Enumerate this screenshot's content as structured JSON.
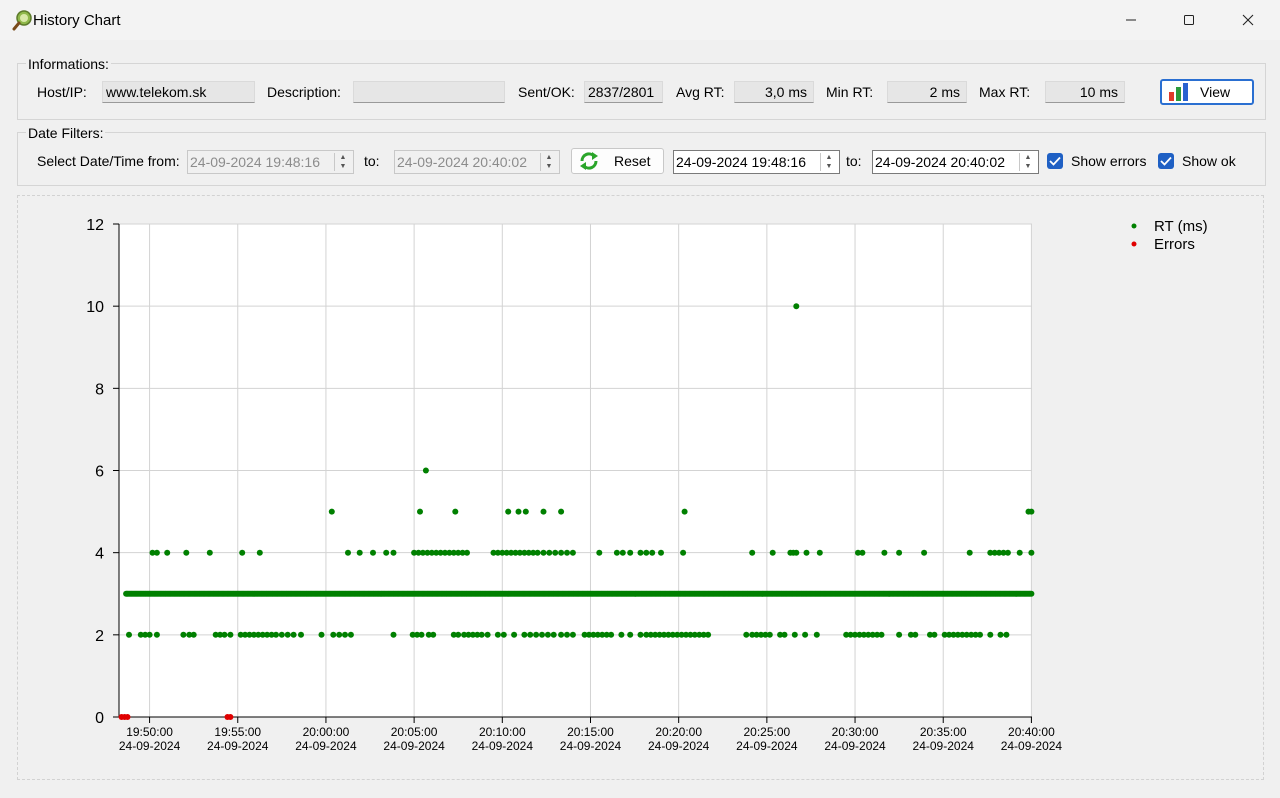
{
  "window": {
    "title": "History Chart"
  },
  "info": {
    "group_label": "Informations:",
    "host_label": "Host/IP:",
    "host_value": "www.telekom.sk",
    "desc_label": "Description:",
    "desc_value": "",
    "sent_label": "Sent/OK:",
    "sent_value": "2837/2801",
    "avg_label": "Avg RT:",
    "avg_value": "3,0 ms",
    "min_label": "Min RT:",
    "min_value": "2 ms",
    "max_label": "Max RT:",
    "max_value": "10 ms",
    "view_label": "View"
  },
  "filters": {
    "group_label": "Date Filters:",
    "from_label": "Select Date/Time from:",
    "from_value": "24-09-2024 19:48:16",
    "to_label": "to:",
    "to_value": "24-09-2024 20:40:02",
    "reset_label": "Reset",
    "from2_value": "24-09-2024 19:48:16",
    "to2_label": "to:",
    "to2_value": "24-09-2024 20:40:02",
    "show_errors_label": "Show errors",
    "show_ok_label": "Show ok",
    "show_errors": true,
    "show_ok": true
  },
  "chart_data": {
    "type": "scatter",
    "ylim": [
      0,
      12
    ],
    "yticks": [
      "0",
      "2",
      "4",
      "6",
      "8",
      "10",
      "12"
    ],
    "xlim": [
      "19:48:16",
      "20:40:02"
    ],
    "xticks": [
      [
        "19:50:00",
        "24-09-2024"
      ],
      [
        "19:55:00",
        "24-09-2024"
      ],
      [
        "20:00:00",
        "24-09-2024"
      ],
      [
        "20:05:00",
        "24-09-2024"
      ],
      [
        "20:10:00",
        "24-09-2024"
      ],
      [
        "20:15:00",
        "24-09-2024"
      ],
      [
        "20:20:00",
        "24-09-2024"
      ],
      [
        "20:25:00",
        "24-09-2024"
      ],
      [
        "20:30:00",
        "24-09-2024"
      ],
      [
        "20:35:00",
        "24-09-2024"
      ],
      [
        "20:40:00",
        "24-09-2024"
      ]
    ],
    "grid": true,
    "legend_position": "top-right",
    "series": [
      {
        "name": "RT (ms)",
        "color": "#008000",
        "level_3_range": [
          "19:48:40",
          "20:40:02"
        ],
        "points": [
          [
            "20:26:40",
            10
          ],
          [
            "20:05:40",
            6
          ],
          [
            "20:00:20",
            5
          ],
          [
            "20:05:20",
            5
          ],
          [
            "20:07:20",
            5
          ],
          [
            "20:10:20",
            5
          ],
          [
            "20:10:55",
            5
          ],
          [
            "20:11:20",
            5
          ],
          [
            "20:12:20",
            5
          ],
          [
            "20:13:20",
            5
          ],
          [
            "20:20:20",
            5
          ],
          [
            "20:39:50",
            5
          ],
          [
            "20:40:00",
            5
          ],
          [
            "19:50:10",
            4
          ],
          [
            "19:50:25",
            4
          ],
          [
            "19:51:00",
            4
          ],
          [
            "19:52:05",
            4
          ],
          [
            "19:53:25",
            4
          ],
          [
            "19:55:15",
            4
          ],
          [
            "19:56:15",
            4
          ],
          [
            "20:01:15",
            4
          ],
          [
            "20:01:55",
            4
          ],
          [
            "20:02:40",
            4
          ],
          [
            "20:03:25",
            4
          ],
          [
            "20:03:50",
            4
          ],
          [
            "20:05:00",
            4
          ],
          [
            "20:05:15",
            4
          ],
          [
            "20:05:30",
            4
          ],
          [
            "20:05:45",
            4
          ],
          [
            "20:06:00",
            4
          ],
          [
            "20:06:15",
            4
          ],
          [
            "20:06:30",
            4
          ],
          [
            "20:06:45",
            4
          ],
          [
            "20:07:00",
            4
          ],
          [
            "20:07:15",
            4
          ],
          [
            "20:07:30",
            4
          ],
          [
            "20:07:45",
            4
          ],
          [
            "20:08:00",
            4
          ],
          [
            "20:09:30",
            4
          ],
          [
            "20:09:45",
            4
          ],
          [
            "20:10:00",
            4
          ],
          [
            "20:10:15",
            4
          ],
          [
            "20:10:30",
            4
          ],
          [
            "20:10:45",
            4
          ],
          [
            "20:11:00",
            4
          ],
          [
            "20:11:15",
            4
          ],
          [
            "20:11:30",
            4
          ],
          [
            "20:11:45",
            4
          ],
          [
            "20:12:00",
            4
          ],
          [
            "20:12:20",
            4
          ],
          [
            "20:12:40",
            4
          ],
          [
            "20:13:00",
            4
          ],
          [
            "20:13:20",
            4
          ],
          [
            "20:13:40",
            4
          ],
          [
            "20:14:00",
            4
          ],
          [
            "20:15:30",
            4
          ],
          [
            "20:16:30",
            4
          ],
          [
            "20:16:50",
            4
          ],
          [
            "20:17:15",
            4
          ],
          [
            "20:17:50",
            4
          ],
          [
            "20:18:10",
            4
          ],
          [
            "20:18:30",
            4
          ],
          [
            "20:19:00",
            4
          ],
          [
            "20:20:15",
            4
          ],
          [
            "20:24:10",
            4
          ],
          [
            "20:25:20",
            4
          ],
          [
            "20:26:20",
            4
          ],
          [
            "20:26:30",
            4
          ],
          [
            "20:26:40",
            4
          ],
          [
            "20:27:15",
            4
          ],
          [
            "20:28:00",
            4
          ],
          [
            "20:30:10",
            4
          ],
          [
            "20:30:25",
            4
          ],
          [
            "20:31:40",
            4
          ],
          [
            "20:32:30",
            4
          ],
          [
            "20:33:55",
            4
          ],
          [
            "20:36:30",
            4
          ],
          [
            "20:37:40",
            4
          ],
          [
            "20:37:55",
            4
          ],
          [
            "20:38:10",
            4
          ],
          [
            "20:38:25",
            4
          ],
          [
            "20:38:40",
            4
          ],
          [
            "20:39:20",
            4
          ],
          [
            "20:40:00",
            4
          ],
          [
            "19:48:50",
            2
          ],
          [
            "19:49:30",
            2
          ],
          [
            "19:49:45",
            2
          ],
          [
            "19:50:00",
            2
          ],
          [
            "19:50:25",
            2
          ],
          [
            "19:51:55",
            2
          ],
          [
            "19:52:15",
            2
          ],
          [
            "19:52:30",
            2
          ],
          [
            "19:53:45",
            2
          ],
          [
            "19:54:00",
            2
          ],
          [
            "19:54:15",
            2
          ],
          [
            "19:54:35",
            2
          ],
          [
            "19:55:10",
            2
          ],
          [
            "19:55:25",
            2
          ],
          [
            "19:55:40",
            2
          ],
          [
            "19:55:55",
            2
          ],
          [
            "19:56:10",
            2
          ],
          [
            "19:56:25",
            2
          ],
          [
            "19:56:40",
            2
          ],
          [
            "19:56:55",
            2
          ],
          [
            "19:57:10",
            2
          ],
          [
            "19:57:30",
            2
          ],
          [
            "19:57:50",
            2
          ],
          [
            "19:58:10",
            2
          ],
          [
            "19:58:35",
            2
          ],
          [
            "19:59:45",
            2
          ],
          [
            "20:00:25",
            2
          ],
          [
            "20:00:45",
            2
          ],
          [
            "20:01:05",
            2
          ],
          [
            "20:01:25",
            2
          ],
          [
            "20:03:50",
            2
          ],
          [
            "20:04:55",
            2
          ],
          [
            "20:05:10",
            2
          ],
          [
            "20:05:25",
            2
          ],
          [
            "20:05:50",
            2
          ],
          [
            "20:06:05",
            2
          ],
          [
            "20:07:15",
            2
          ],
          [
            "20:07:30",
            2
          ],
          [
            "20:07:50",
            2
          ],
          [
            "20:08:05",
            2
          ],
          [
            "20:08:20",
            2
          ],
          [
            "20:08:35",
            2
          ],
          [
            "20:08:50",
            2
          ],
          [
            "20:09:10",
            2
          ],
          [
            "20:09:45",
            2
          ],
          [
            "20:10:05",
            2
          ],
          [
            "20:10:40",
            2
          ],
          [
            "20:11:15",
            2
          ],
          [
            "20:11:35",
            2
          ],
          [
            "20:11:55",
            2
          ],
          [
            "20:12:15",
            2
          ],
          [
            "20:12:35",
            2
          ],
          [
            "20:12:55",
            2
          ],
          [
            "20:13:20",
            2
          ],
          [
            "20:13:40",
            2
          ],
          [
            "20:14:00",
            2
          ],
          [
            "20:14:40",
            2
          ],
          [
            "20:14:55",
            2
          ],
          [
            "20:15:10",
            2
          ],
          [
            "20:15:25",
            2
          ],
          [
            "20:15:40",
            2
          ],
          [
            "20:15:55",
            2
          ],
          [
            "20:16:10",
            2
          ],
          [
            "20:16:45",
            2
          ],
          [
            "20:17:15",
            2
          ],
          [
            "20:17:50",
            2
          ],
          [
            "20:18:10",
            2
          ],
          [
            "20:18:25",
            2
          ],
          [
            "20:18:40",
            2
          ],
          [
            "20:18:55",
            2
          ],
          [
            "20:19:10",
            2
          ],
          [
            "20:19:25",
            2
          ],
          [
            "20:19:40",
            2
          ],
          [
            "20:19:55",
            2
          ],
          [
            "20:20:10",
            2
          ],
          [
            "20:20:25",
            2
          ],
          [
            "20:20:40",
            2
          ],
          [
            "20:20:55",
            2
          ],
          [
            "20:21:10",
            2
          ],
          [
            "20:21:25",
            2
          ],
          [
            "20:21:40",
            2
          ],
          [
            "20:23:50",
            2
          ],
          [
            "20:24:10",
            2
          ],
          [
            "20:24:25",
            2
          ],
          [
            "20:24:40",
            2
          ],
          [
            "20:24:55",
            2
          ],
          [
            "20:25:10",
            2
          ],
          [
            "20:25:45",
            2
          ],
          [
            "20:26:00",
            2
          ],
          [
            "20:26:35",
            2
          ],
          [
            "20:27:10",
            2
          ],
          [
            "20:27:50",
            2
          ],
          [
            "20:29:30",
            2
          ],
          [
            "20:29:45",
            2
          ],
          [
            "20:30:00",
            2
          ],
          [
            "20:30:15",
            2
          ],
          [
            "20:30:30",
            2
          ],
          [
            "20:30:45",
            2
          ],
          [
            "20:31:00",
            2
          ],
          [
            "20:31:15",
            2
          ],
          [
            "20:31:30",
            2
          ],
          [
            "20:32:30",
            2
          ],
          [
            "20:33:10",
            2
          ],
          [
            "20:33:25",
            2
          ],
          [
            "20:34:15",
            2
          ],
          [
            "20:34:30",
            2
          ],
          [
            "20:35:05",
            2
          ],
          [
            "20:35:20",
            2
          ],
          [
            "20:35:35",
            2
          ],
          [
            "20:35:50",
            2
          ],
          [
            "20:36:05",
            2
          ],
          [
            "20:36:20",
            2
          ],
          [
            "20:36:35",
            2
          ],
          [
            "20:36:50",
            2
          ],
          [
            "20:37:05",
            2
          ],
          [
            "20:37:40",
            2
          ],
          [
            "20:38:15",
            2
          ],
          [
            "20:38:35",
            2
          ]
        ]
      },
      {
        "name": "Errors",
        "color": "#e00000",
        "points": [
          [
            "19:48:25",
            0
          ],
          [
            "19:48:35",
            0
          ],
          [
            "19:48:45",
            0
          ],
          [
            "19:54:25",
            0
          ],
          [
            "19:54:35",
            0
          ]
        ]
      }
    ]
  }
}
